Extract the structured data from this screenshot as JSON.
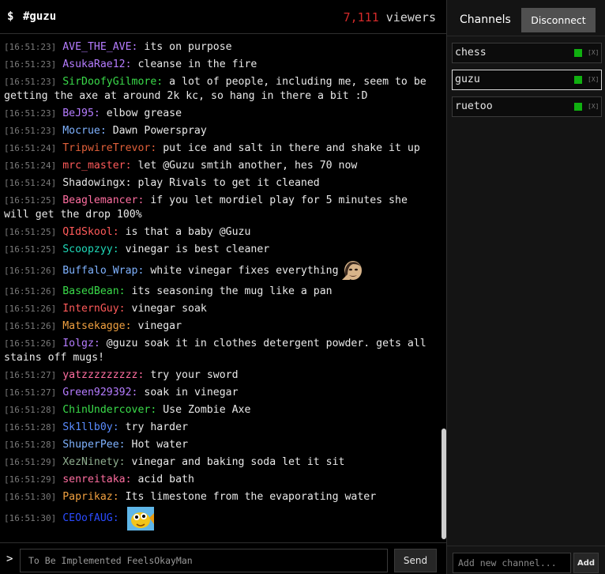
{
  "header": {
    "prompt": "$",
    "channel": "#guzu",
    "viewer_count": "7,111",
    "viewer_label": "viewers"
  },
  "chat": {
    "messages": [
      {
        "time": "[16:51:23]",
        "user": "AVE_THE_AVE",
        "color": "#b57cff",
        "text": "its on purpose"
      },
      {
        "time": "[16:51:23]",
        "user": "AsukaRae12",
        "color": "#b57cff",
        "text": "cleanse in the fire"
      },
      {
        "time": "[16:51:23]",
        "user": "SirDoofyGilmore",
        "color": "#3adb4a",
        "text": "a lot of people, including me, seem to be getting the axe at around 2k kc, so hang in there a bit :D"
      },
      {
        "time": "[16:51:23]",
        "user": "BeJ95",
        "color": "#b57cff",
        "text": "elbow grease"
      },
      {
        "time": "[16:51:23]",
        "user": "Mocrue",
        "color": "#7fb2ff",
        "text": "Dawn Powerspray"
      },
      {
        "time": "[16:51:24]",
        "user": "TripwireTrevor",
        "color": "#e2603a",
        "text": "put ice and salt in there and shake it up"
      },
      {
        "time": "[16:51:24]",
        "user": "mrc_master",
        "color": "#ff5a5a",
        "text": "let @Guzu smtih another, hes 70 now"
      },
      {
        "time": "[16:51:24]",
        "user": "Shadowingx",
        "color": "#e6e6e6",
        "text": "play Rivals to get it cleaned"
      },
      {
        "time": "[16:51:25]",
        "user": "Beaglemancer",
        "color": "#ff6ea0",
        "text": "if you let mordiel play for 5 minutes she will get the drop 100%"
      },
      {
        "time": "[16:51:25]",
        "user": "QIdSkool",
        "color": "#ff5a5a",
        "text": "is that a baby @Guzu"
      },
      {
        "time": "[16:51:25]",
        "user": "Scoopzyy",
        "color": "#1fd8b8",
        "text": "vinegar is best cleaner"
      },
      {
        "time": "[16:51:26]",
        "user": "Buffalo_Wrap",
        "color": "#7fb2ff",
        "text": "white vinegar fixes everything",
        "emote": "face-emote"
      },
      {
        "time": "[16:51:26]",
        "user": "BasedBean",
        "color": "#3adb4a",
        "text": "its seasoning the mug like a pan"
      },
      {
        "time": "[16:51:26]",
        "user": "InternGuy",
        "color": "#ff5a5a",
        "text": "vinegar soak"
      },
      {
        "time": "[16:51:26]",
        "user": "Matsekagge",
        "color": "#f0a040",
        "text": "vinegar"
      },
      {
        "time": "[16:51:26]",
        "user": "Iolgz",
        "color": "#b57cff",
        "text": "@guzu soak it in clothes detergent powder. gets all stains off mugs!"
      },
      {
        "time": "[16:51:27]",
        "user": "yatzzzzzzzzz",
        "color": "#ff6ea0",
        "text": "try your sword"
      },
      {
        "time": "[16:51:27]",
        "user": "Green929392",
        "color": "#b57cff",
        "text": "soak in vinegar"
      },
      {
        "time": "[16:51:28]",
        "user": "ChinUndercover",
        "color": "#3adb4a",
        "text": "Use Zombie Axe"
      },
      {
        "time": "[16:51:28]",
        "user": "Sk1llb0y",
        "color": "#5a8cff",
        "text": "try harder"
      },
      {
        "time": "[16:51:28]",
        "user": "ShuperPee",
        "color": "#7fb2ff",
        "text": "Hot water"
      },
      {
        "time": "[16:51:29]",
        "user": "XezNinety",
        "color": "#8fae8f",
        "text": "vinegar and baking soda let it sit"
      },
      {
        "time": "[16:51:29]",
        "user": "senreitaka",
        "color": "#ff6ea0",
        "text": "acid bath"
      },
      {
        "time": "[16:51:30]",
        "user": "Paprikaz",
        "color": "#f0a040",
        "text": "Its limestone from the evaporating water"
      },
      {
        "time": "[16:51:30]",
        "user": "CEOofAUG",
        "color": "#2a4bff",
        "text": "",
        "emote": "fish-emote"
      }
    ]
  },
  "input": {
    "caret": ">",
    "placeholder": "To Be Implemented FeelsOkayMan",
    "send_label": "Send"
  },
  "sidebar": {
    "heading": "Channels",
    "disconnect_label": "Disconnect",
    "channels": [
      {
        "name": "chess",
        "close": "[X]",
        "active": false
      },
      {
        "name": "guzu",
        "close": "[X]",
        "active": true
      },
      {
        "name": "ruetoo",
        "close": "[X]",
        "active": false
      }
    ],
    "new_channel_placeholder": "Add new channel...",
    "add_label": "Add"
  },
  "colors": {
    "viewer_count": "#d42a2a",
    "status_online": "#10b010"
  }
}
